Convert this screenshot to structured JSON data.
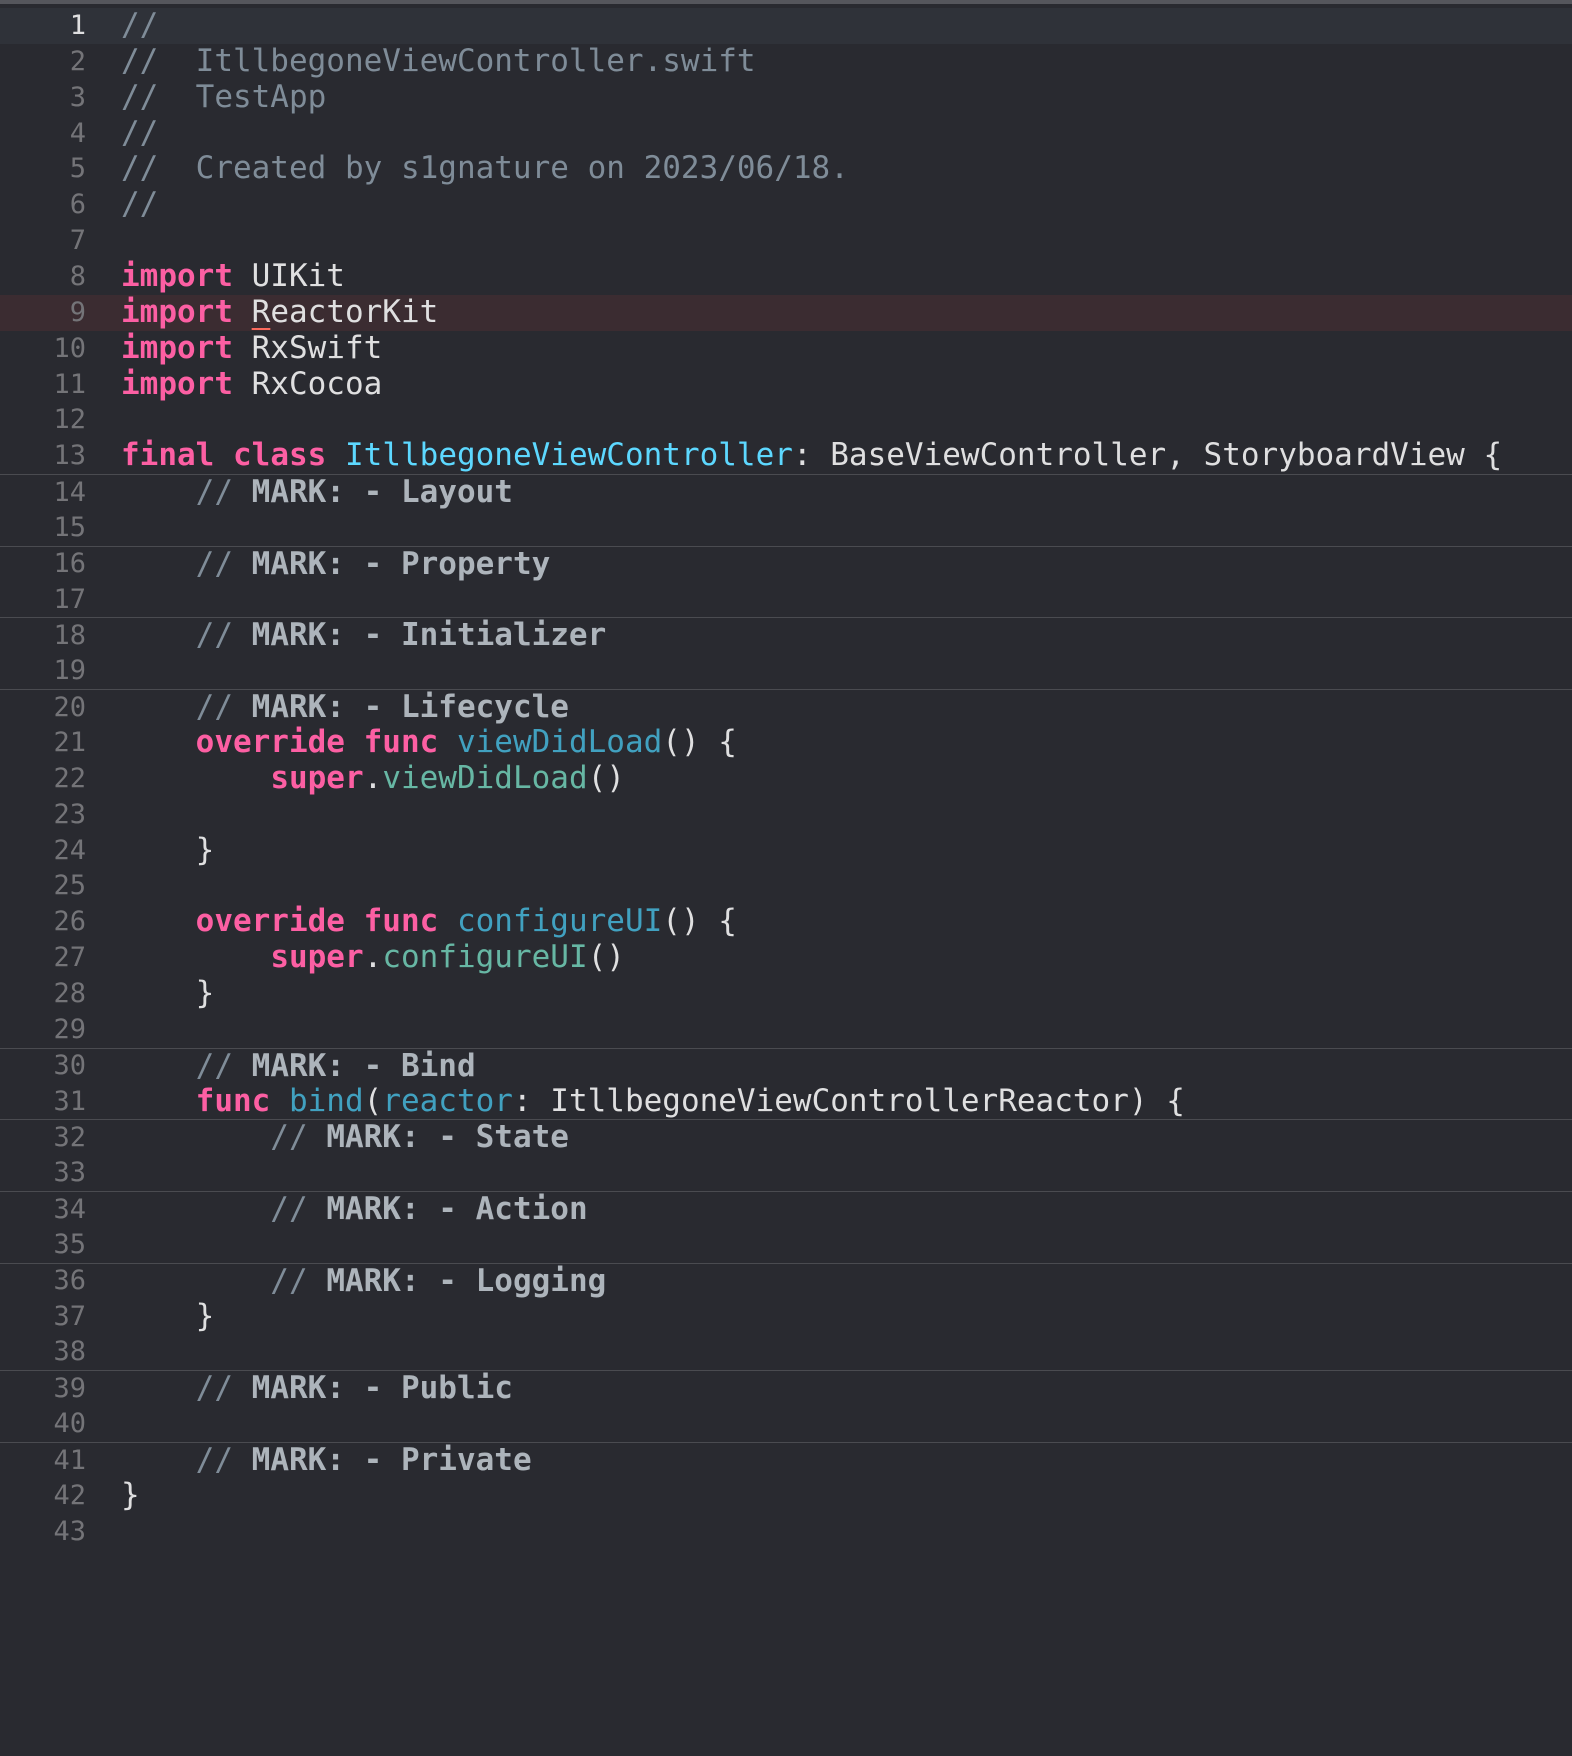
{
  "editor": {
    "file_name": "ItllbegoneViewController.swift",
    "current_line": 1,
    "error_line": 9,
    "colors": {
      "background": "#292a30",
      "comment": "#7f8c98",
      "mark": "#adb4bb",
      "keyword": "#fc5fa3",
      "type_declaration": "#5dd8ff",
      "function_declaration": "#41a1c0",
      "method_call": "#67b7a4",
      "plain": "#dfdfe0",
      "error_line_highlight": "#3b2c31"
    },
    "lines": [
      {
        "n": "1",
        "tokens": [
          {
            "t": "//",
            "k": "comment"
          }
        ]
      },
      {
        "n": "2",
        "tokens": [
          {
            "t": "//  ItllbegoneViewController.swift",
            "k": "comment"
          }
        ]
      },
      {
        "n": "3",
        "tokens": [
          {
            "t": "//  TestApp",
            "k": "comment"
          }
        ]
      },
      {
        "n": "4",
        "tokens": [
          {
            "t": "//",
            "k": "comment"
          }
        ]
      },
      {
        "n": "5",
        "tokens": [
          {
            "t": "//  Created by s1gnature on 2023/06/18.",
            "k": "comment"
          }
        ]
      },
      {
        "n": "6",
        "tokens": [
          {
            "t": "//",
            "k": "comment"
          }
        ]
      },
      {
        "n": "7",
        "tokens": []
      },
      {
        "n": "8",
        "tokens": [
          {
            "t": "import",
            "k": "kw"
          },
          {
            "t": " UIKit",
            "k": "plain"
          }
        ]
      },
      {
        "n": "9",
        "tokens": [
          {
            "t": "import",
            "k": "kw"
          },
          {
            "t": " ",
            "k": "plain"
          },
          {
            "t": "R",
            "k": "plain-err"
          },
          {
            "t": "eactorKit",
            "k": "plain"
          }
        ]
      },
      {
        "n": "10",
        "tokens": [
          {
            "t": "import",
            "k": "kw"
          },
          {
            "t": " RxSwift",
            "k": "plain"
          }
        ]
      },
      {
        "n": "11",
        "tokens": [
          {
            "t": "import",
            "k": "kw"
          },
          {
            "t": " RxCocoa",
            "k": "plain"
          }
        ]
      },
      {
        "n": "12",
        "tokens": []
      },
      {
        "n": "13",
        "tokens": [
          {
            "t": "final",
            "k": "kw"
          },
          {
            "t": " ",
            "k": "plain"
          },
          {
            "t": "class",
            "k": "kw"
          },
          {
            "t": " ",
            "k": "plain"
          },
          {
            "t": "ItllbegoneViewController",
            "k": "type-decl"
          },
          {
            "t": ": BaseViewController, StoryboardView {",
            "k": "plain"
          }
        ]
      },
      {
        "n": "14",
        "sep": true,
        "tokens": [
          {
            "t": "    // ",
            "k": "comment"
          },
          {
            "t": "MARK: - Layout",
            "k": "mark"
          }
        ]
      },
      {
        "n": "15",
        "tokens": []
      },
      {
        "n": "16",
        "sep": true,
        "tokens": [
          {
            "t": "    // ",
            "k": "comment"
          },
          {
            "t": "MARK: - Property",
            "k": "mark"
          }
        ]
      },
      {
        "n": "17",
        "tokens": []
      },
      {
        "n": "18",
        "sep": true,
        "tokens": [
          {
            "t": "    // ",
            "k": "comment"
          },
          {
            "t": "MARK: - Initializer",
            "k": "mark"
          }
        ]
      },
      {
        "n": "19",
        "tokens": []
      },
      {
        "n": "20",
        "sep": true,
        "tokens": [
          {
            "t": "    // ",
            "k": "comment"
          },
          {
            "t": "MARK: - Lifecycle",
            "k": "mark"
          }
        ]
      },
      {
        "n": "21",
        "tokens": [
          {
            "t": "    ",
            "k": "plain"
          },
          {
            "t": "override",
            "k": "kw"
          },
          {
            "t": " ",
            "k": "plain"
          },
          {
            "t": "func",
            "k": "kw"
          },
          {
            "t": " ",
            "k": "plain"
          },
          {
            "t": "viewDidLoad",
            "k": "fn-decl"
          },
          {
            "t": "() {",
            "k": "plain"
          }
        ]
      },
      {
        "n": "22",
        "tokens": [
          {
            "t": "        ",
            "k": "plain"
          },
          {
            "t": "super",
            "k": "kw"
          },
          {
            "t": ".",
            "k": "plain"
          },
          {
            "t": "viewDidLoad",
            "k": "method"
          },
          {
            "t": "()",
            "k": "plain"
          }
        ]
      },
      {
        "n": "23",
        "tokens": []
      },
      {
        "n": "24",
        "tokens": [
          {
            "t": "    }",
            "k": "plain"
          }
        ]
      },
      {
        "n": "25",
        "tokens": []
      },
      {
        "n": "26",
        "tokens": [
          {
            "t": "    ",
            "k": "plain"
          },
          {
            "t": "override",
            "k": "kw"
          },
          {
            "t": " ",
            "k": "plain"
          },
          {
            "t": "func",
            "k": "kw"
          },
          {
            "t": " ",
            "k": "plain"
          },
          {
            "t": "configureUI",
            "k": "fn-decl"
          },
          {
            "t": "() {",
            "k": "plain"
          }
        ]
      },
      {
        "n": "27",
        "tokens": [
          {
            "t": "        ",
            "k": "plain"
          },
          {
            "t": "super",
            "k": "kw"
          },
          {
            "t": ".",
            "k": "plain"
          },
          {
            "t": "configureUI",
            "k": "method"
          },
          {
            "t": "()",
            "k": "plain"
          }
        ]
      },
      {
        "n": "28",
        "tokens": [
          {
            "t": "    }",
            "k": "plain"
          }
        ]
      },
      {
        "n": "29",
        "tokens": []
      },
      {
        "n": "30",
        "sep": true,
        "tokens": [
          {
            "t": "    // ",
            "k": "comment"
          },
          {
            "t": "MARK: - Bind",
            "k": "mark"
          }
        ]
      },
      {
        "n": "31",
        "tokens": [
          {
            "t": "    ",
            "k": "plain"
          },
          {
            "t": "func",
            "k": "kw"
          },
          {
            "t": " ",
            "k": "plain"
          },
          {
            "t": "bind",
            "k": "fn-decl"
          },
          {
            "t": "(",
            "k": "plain"
          },
          {
            "t": "reactor",
            "k": "fn-decl"
          },
          {
            "t": ": ItllbegoneViewControllerReactor) {",
            "k": "plain"
          }
        ]
      },
      {
        "n": "32",
        "sep": true,
        "tokens": [
          {
            "t": "        // ",
            "k": "comment"
          },
          {
            "t": "MARK: - State",
            "k": "mark"
          }
        ]
      },
      {
        "n": "33",
        "tokens": []
      },
      {
        "n": "34",
        "sep": true,
        "tokens": [
          {
            "t": "        // ",
            "k": "comment"
          },
          {
            "t": "MARK: - Action",
            "k": "mark"
          }
        ]
      },
      {
        "n": "35",
        "tokens": []
      },
      {
        "n": "36",
        "sep": true,
        "tokens": [
          {
            "t": "        // ",
            "k": "comment"
          },
          {
            "t": "MARK: - Logging",
            "k": "mark"
          }
        ]
      },
      {
        "n": "37",
        "tokens": [
          {
            "t": "    }",
            "k": "plain"
          }
        ]
      },
      {
        "n": "38",
        "tokens": []
      },
      {
        "n": "39",
        "sep": true,
        "tokens": [
          {
            "t": "    // ",
            "k": "comment"
          },
          {
            "t": "MARK: - Public",
            "k": "mark"
          }
        ]
      },
      {
        "n": "40",
        "tokens": []
      },
      {
        "n": "41",
        "sep": true,
        "tokens": [
          {
            "t": "    // ",
            "k": "comment"
          },
          {
            "t": "MARK: - Private",
            "k": "mark"
          }
        ]
      },
      {
        "n": "42",
        "tokens": [
          {
            "t": "}",
            "k": "plain"
          }
        ]
      },
      {
        "n": "43",
        "tokens": []
      }
    ]
  }
}
